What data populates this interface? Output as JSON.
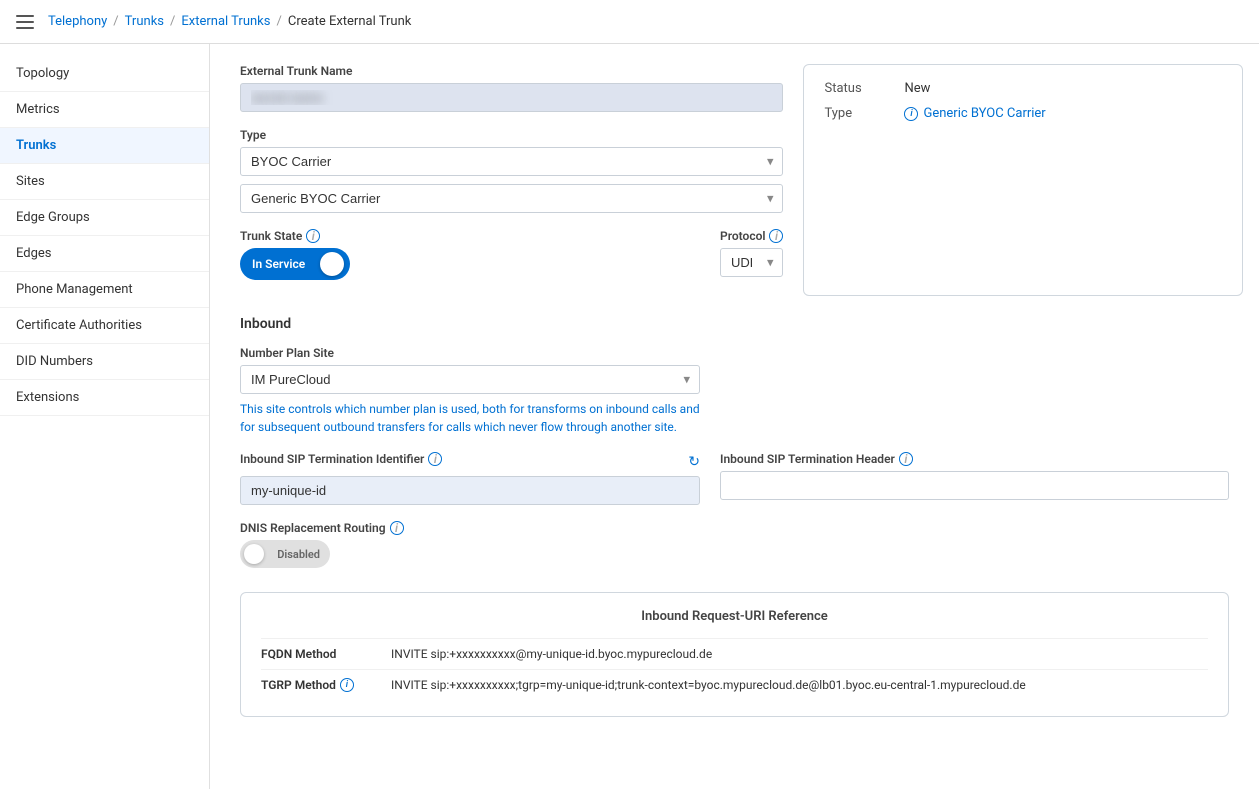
{
  "breadcrumb": {
    "items": [
      "Telephony",
      "Trunks",
      "External Trunks",
      "Create External Trunk"
    ],
    "links": [
      true,
      true,
      true,
      false
    ]
  },
  "sidebar": {
    "items": [
      {
        "id": "topology",
        "label": "Topology",
        "active": false
      },
      {
        "id": "metrics",
        "label": "Metrics",
        "active": false
      },
      {
        "id": "trunks",
        "label": "Trunks",
        "active": true
      },
      {
        "id": "sites",
        "label": "Sites",
        "active": false
      },
      {
        "id": "edge-groups",
        "label": "Edge Groups",
        "active": false
      },
      {
        "id": "edges",
        "label": "Edges",
        "active": false
      },
      {
        "id": "phone-management",
        "label": "Phone Management",
        "active": false
      },
      {
        "id": "certificate-authorities",
        "label": "Certificate Authorities",
        "active": false
      },
      {
        "id": "did-numbers",
        "label": "DID Numbers",
        "active": false
      },
      {
        "id": "extensions",
        "label": "Extensions",
        "active": false
      }
    ]
  },
  "form": {
    "external_trunk_name_label": "External Trunk Name",
    "external_trunk_name_value": "••••••••••••",
    "type_label": "Type",
    "type_option1": "BYOC Carrier",
    "type_option2": "Generic BYOC Carrier",
    "trunk_state_label": "Trunk State",
    "trunk_state_value": "In Service",
    "protocol_label": "Protocol",
    "protocol_value": "UDP",
    "status_card": {
      "status_label": "Status",
      "status_value": "New",
      "type_label": "Type",
      "type_value": "Generic BYOC Carrier"
    },
    "inbound": {
      "title": "Inbound",
      "number_plan_site_label": "Number Plan Site",
      "number_plan_site_value": "IM PureCloud",
      "hint_text": "This site controls which number plan is used, both for transforms on inbound calls and for subsequent outbound transfers for calls which never flow through another site.",
      "sip_termination_id_label": "Inbound SIP Termination Identifier",
      "sip_termination_id_value": "my-unique-id",
      "sip_termination_header_label": "Inbound SIP Termination Header",
      "sip_termination_header_value": "",
      "dnis_label": "DNIS Replacement Routing",
      "dnis_state": "Disabled"
    },
    "reference_card": {
      "title": "Inbound Request-URI Reference",
      "fqdn_label": "FQDN Method",
      "fqdn_value": "INVITE sip:+xxxxxxxxxx@my-unique-id.byoc.mypurecloud.de",
      "tgrp_label": "TGRP Method",
      "tgrp_value": "INVITE sip:+xxxxxxxxxx;tgrp=my-unique-id;trunk-context=byoc.mypurecloud.de@lb01.byoc.eu-central-1.mypurecloud.de"
    }
  },
  "icons": {
    "hamburger": "☰",
    "chevron_down": "▾",
    "info": "i",
    "refresh": "↻"
  }
}
